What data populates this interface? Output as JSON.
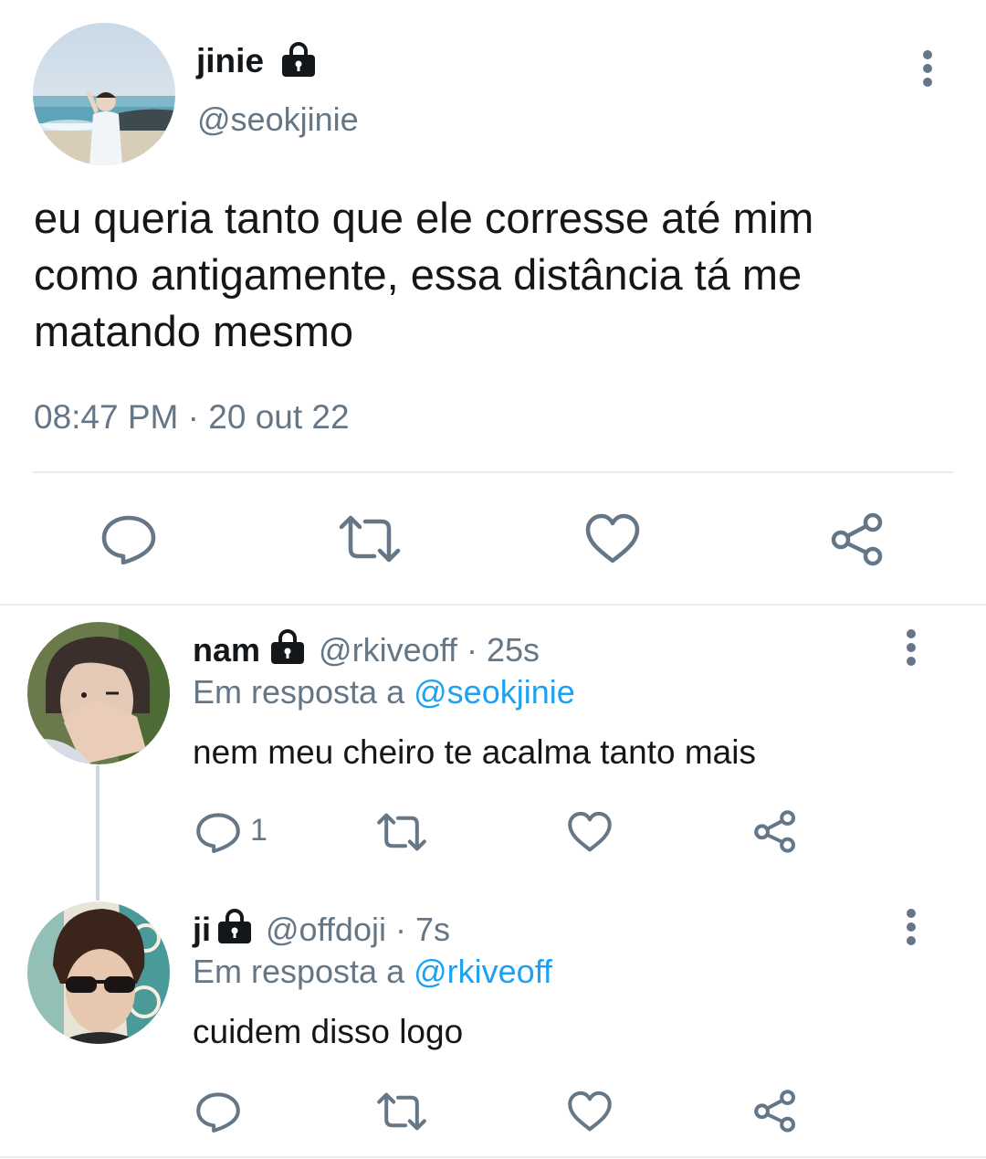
{
  "main_tweet": {
    "display_name": "jinie",
    "handle": "@seokjinie",
    "text_lines": [
      "eu queria tanto que ele corresse até mim",
      "como antigamente, essa distância tá me",
      "matando mesmo"
    ],
    "time": "08:47 PM",
    "separator": "·",
    "date": "20 out 22",
    "actions": [
      "reply-icon",
      "retweet-icon",
      "like-icon",
      "share-icon"
    ]
  },
  "replies": [
    {
      "display_name": "nam",
      "handle": "@rkiveoff",
      "age": "· 25s",
      "reply_prefix": "Em resposta a",
      "reply_to": "@seokjinie",
      "text": "nem meu cheiro te acalma tanto mais",
      "reply_count": "1"
    },
    {
      "display_name": "ji",
      "handle": "@offdoji",
      "age": "· 7s",
      "reply_prefix": "Em resposta a",
      "reply_to": "@rkiveoff",
      "text": "cuidem disso logo",
      "reply_count": ""
    }
  ],
  "colors": {
    "text": "#14171a",
    "secondary": "#657786",
    "link": "#1da1f2",
    "divider": "#e6ecf0"
  }
}
